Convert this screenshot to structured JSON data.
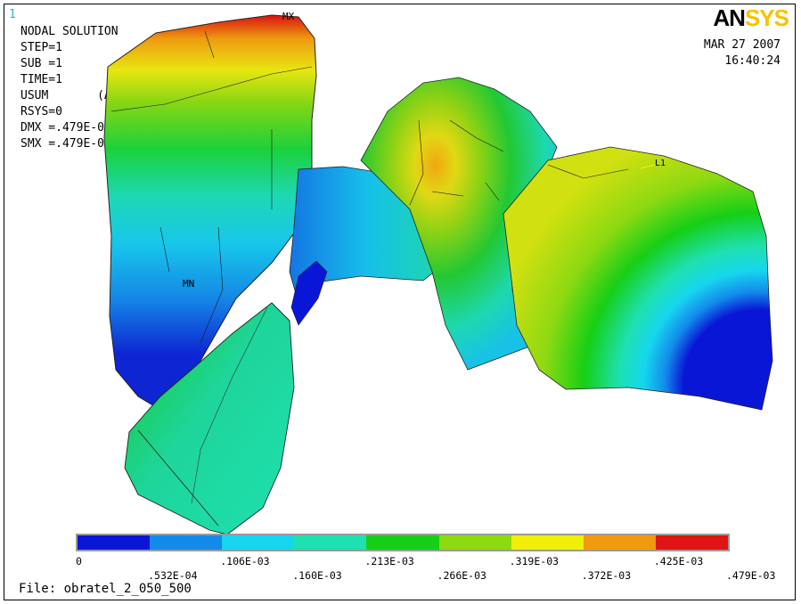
{
  "window_number": "1",
  "logo": {
    "part1": "AN",
    "part2": "SYS"
  },
  "info": {
    "title": "NODAL SOLUTION",
    "step": "STEP=1",
    "sub": "SUB =1",
    "time": "TIME=1",
    "usum": "USUM       (AVG)",
    "rsys": "RSYS=0",
    "dmx": "DMX =.479E-03",
    "smx": "SMX =.479E-03"
  },
  "date": "MAR 27 2007",
  "time": "16:40:24",
  "markers": {
    "mx": "MX",
    "mn": "MN",
    "l1": "L1"
  },
  "legend": {
    "colors": [
      "#0a16d6",
      "#138bea",
      "#16d6ee",
      "#1ee0b0",
      "#16cf16",
      "#8ed912",
      "#f0ef08",
      "#f09a0e",
      "#e01414"
    ],
    "labels_top": [
      "0",
      ".106E-03",
      ".213E-03",
      ".319E-03",
      ".425E-03"
    ],
    "labels_bottom": [
      ".532E-04",
      ".160E-03",
      ".266E-03",
      ".372E-03",
      ".479E-03"
    ]
  },
  "file": "File: obratel_2_050_500"
}
